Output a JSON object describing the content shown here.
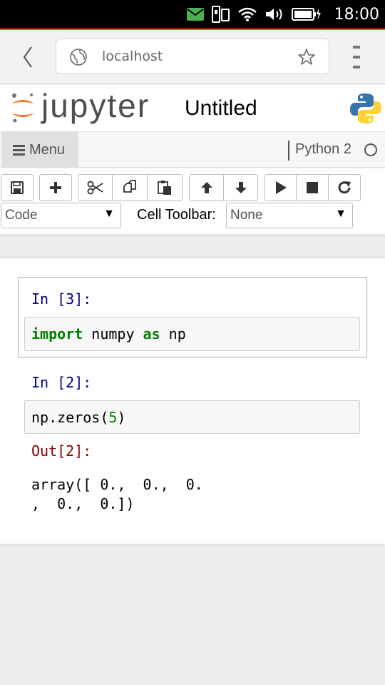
{
  "status_bar": {
    "time": "18:00",
    "icons": [
      "mail-icon",
      "dual-sim-icon",
      "wifi-icon",
      "volume-icon",
      "battery-charging-icon"
    ],
    "mail_color": "#4caf50"
  },
  "browser": {
    "url": "localhost",
    "accent_color": "#e95420"
  },
  "header": {
    "brand": "jupyter",
    "notebook_title": "Untitled"
  },
  "menubar": {
    "menu_label": "Menu",
    "kernel_name": "Python 2"
  },
  "toolbar": {
    "buttons": [
      "save-icon",
      "plus-icon",
      "cut-icon",
      "copy-icon",
      "paste-icon",
      "arrow-up-icon",
      "arrow-down-icon",
      "run-icon",
      "stop-icon",
      "restart-icon"
    ],
    "cell_type": "Code",
    "cell_toolbar_label": "Cell Toolbar:",
    "cell_toolbar_value": "None",
    "dropdown_arrow": "▼"
  },
  "cells": [
    {
      "prompt": "In [3]:",
      "code": {
        "keyword1": "import",
        "mid": " numpy ",
        "keyword2": "as",
        "rest": " np"
      }
    },
    {
      "prompt": "In [2]:",
      "code": {
        "pre": "np.zeros(",
        "num": "5",
        "post": ")"
      },
      "out_prompt": "Out[2]:",
      "output_line1": "array([ 0.,  0.,  0.",
      "output_line2": ",  0.,  0.])"
    }
  ]
}
